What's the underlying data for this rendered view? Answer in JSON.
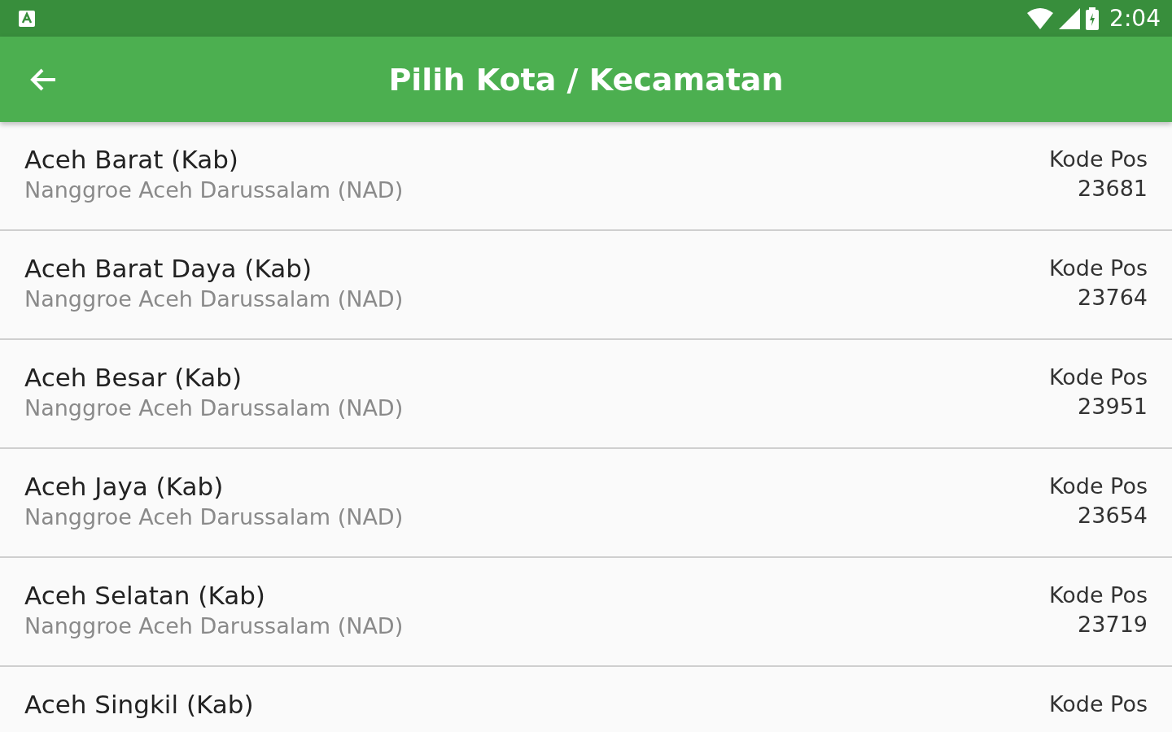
{
  "status_bar": {
    "time": "2:04"
  },
  "app_bar": {
    "title": "Pilih Kota / Kecamatan"
  },
  "rows": [
    {
      "name": "Aceh Barat (Kab)",
      "province": "Nanggroe Aceh Darussalam (NAD)",
      "code_label": "Kode Pos",
      "code": "23681"
    },
    {
      "name": "Aceh Barat Daya (Kab)",
      "province": "Nanggroe Aceh Darussalam (NAD)",
      "code_label": "Kode Pos",
      "code": "23764"
    },
    {
      "name": "Aceh Besar (Kab)",
      "province": "Nanggroe Aceh Darussalam (NAD)",
      "code_label": "Kode Pos",
      "code": "23951"
    },
    {
      "name": "Aceh Jaya (Kab)",
      "province": "Nanggroe Aceh Darussalam (NAD)",
      "code_label": "Kode Pos",
      "code": "23654"
    },
    {
      "name": "Aceh Selatan (Kab)",
      "province": "Nanggroe Aceh Darussalam (NAD)",
      "code_label": "Kode Pos",
      "code": "23719"
    },
    {
      "name": "Aceh Singkil (Kab)",
      "code_label": "Kode Pos"
    }
  ]
}
